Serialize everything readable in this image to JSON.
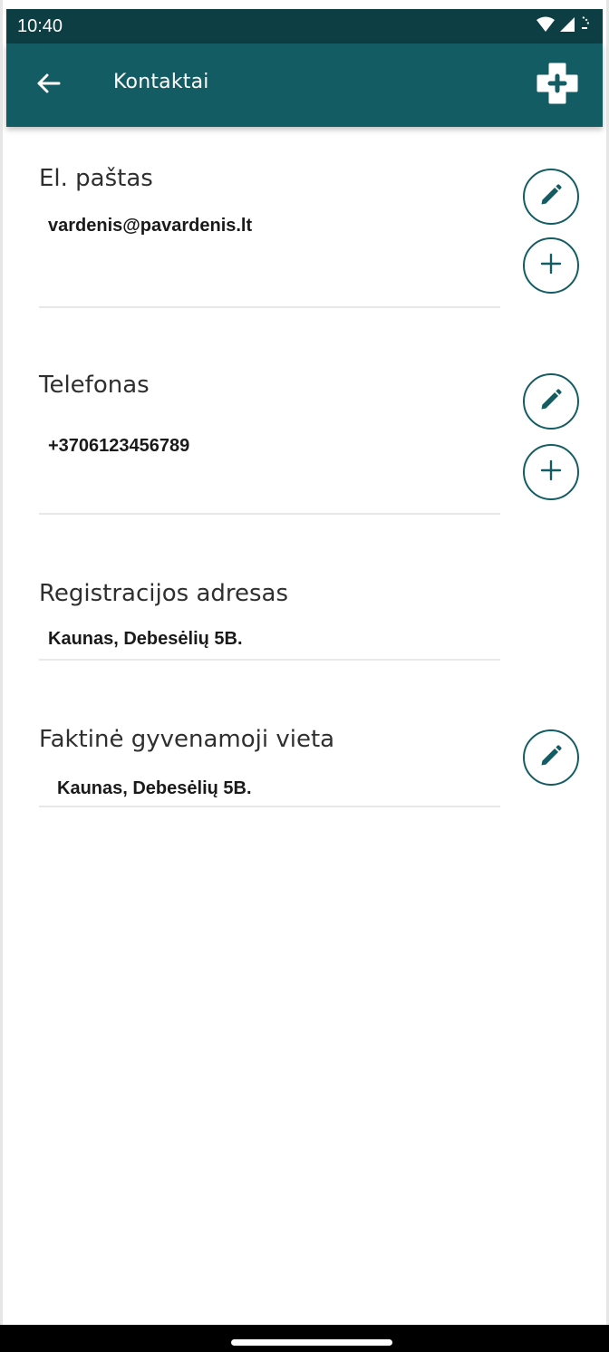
{
  "status_bar": {
    "time": "10:40",
    "icons": [
      "wifi-icon",
      "signal-icon",
      "battery-icon"
    ]
  },
  "app_bar": {
    "title": "Kontaktai",
    "back_icon": "arrow-left-icon",
    "action_icon": "add-contact-icon"
  },
  "sections": {
    "email": {
      "label": "El. paštas",
      "value": "vardenis@pavardenis.lt"
    },
    "phone": {
      "label": "Telefonas",
      "value": "+3706123456789"
    },
    "registration_address": {
      "label": "Registracijos adresas",
      "value": "Kaunas, Debesėlių 5B."
    },
    "actual_residence": {
      "label": "Faktinė gyvenamoji vieta",
      "value": "Kaunas, Debesėlių 5B."
    }
  },
  "colors": {
    "app_bar": "#145c63",
    "status_bar": "#0d3e44",
    "accent": "#145c63",
    "text": "#2f2f2f"
  }
}
